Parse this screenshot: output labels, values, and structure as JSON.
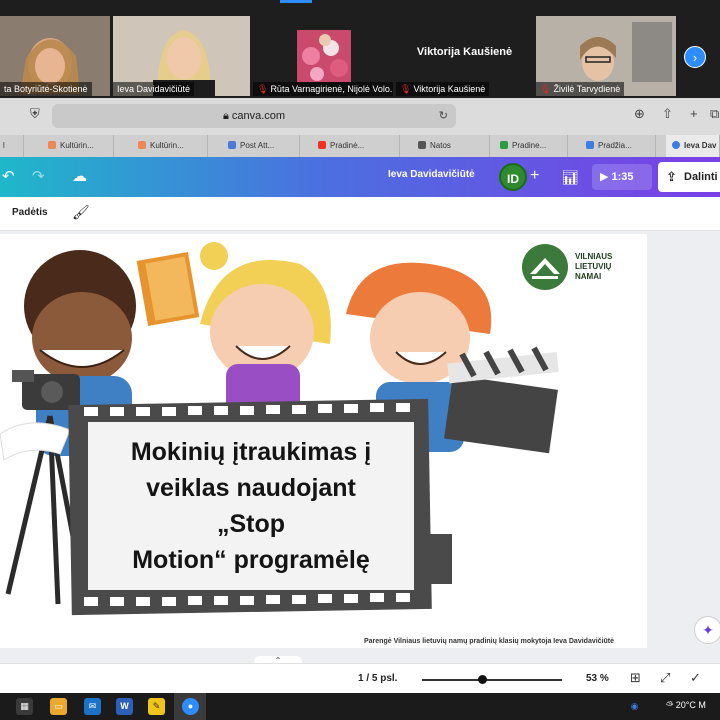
{
  "meeting": {
    "participants": [
      {
        "name": "ta Botyriūtė-Skotienė",
        "muted": false
      },
      {
        "name": "Ieva Davidavičiūtė",
        "muted": false
      },
      {
        "name": "Rūta Varnagirienė, Nijolė Volo...",
        "muted": true
      },
      {
        "name": "Viktorija Kaušienė",
        "muted": true,
        "center_name": "Viktorija Kaušienė"
      },
      {
        "name": "Živilė Tarvydienė",
        "muted": true
      }
    ],
    "mic_glyph": "🎙"
  },
  "browser": {
    "url": "canva.com",
    "tabs": [
      "l",
      "Kultūrin...",
      "Kultūrin...",
      "Post Att...",
      "Pradinė...",
      "Natos",
      "Pradine...",
      "Pradžia...",
      "Ieva Dav"
    ]
  },
  "canva": {
    "owner": "Ieva Davidavičiūtė",
    "avatar_initials": "ID",
    "play_time": "1:35",
    "share_label": "Dalinti",
    "toolbar_position": "Padėtis",
    "footer": {
      "page_count": "1 / 5 psl.",
      "zoom": "53 %",
      "zoom_level": 0.43
    },
    "colors": {
      "header_start": "#1fb7c9",
      "header_end": "#7a3fe6",
      "avatar": "#2f8a2f"
    }
  },
  "slide": {
    "title_lines": [
      "Mokinių įtraukimas į",
      "veiklas naudojant",
      "„Stop",
      "Motion“ programėlę"
    ],
    "logo_lines": [
      "VILNIAUS",
      "LIETUVIŲ",
      "NAMAI"
    ],
    "credit": "Parengė Vilniaus lietuvių namų pradinių klasių mokytoja Ieva Davidavičiūtė"
  },
  "taskbar": {
    "weather": "20°C",
    "edge_letter": "M"
  },
  "icons": {
    "next": "chevron-right-icon",
    "shield": "shield-icon",
    "lock": "lock-icon",
    "download": "download-icon",
    "share": "share-icon",
    "new_tab": "plus-icon",
    "tabs": "tabs-icon",
    "undo": "undo-icon",
    "redo": "redo-icon",
    "cloud": "cloud-icon",
    "chart": "chart-icon",
    "play": "play-icon",
    "brush": "paint-brush-icon",
    "magic": "magic-icon",
    "grid": "grid-icon",
    "fullscreen": "fullscreen-icon",
    "check": "check-icon"
  }
}
